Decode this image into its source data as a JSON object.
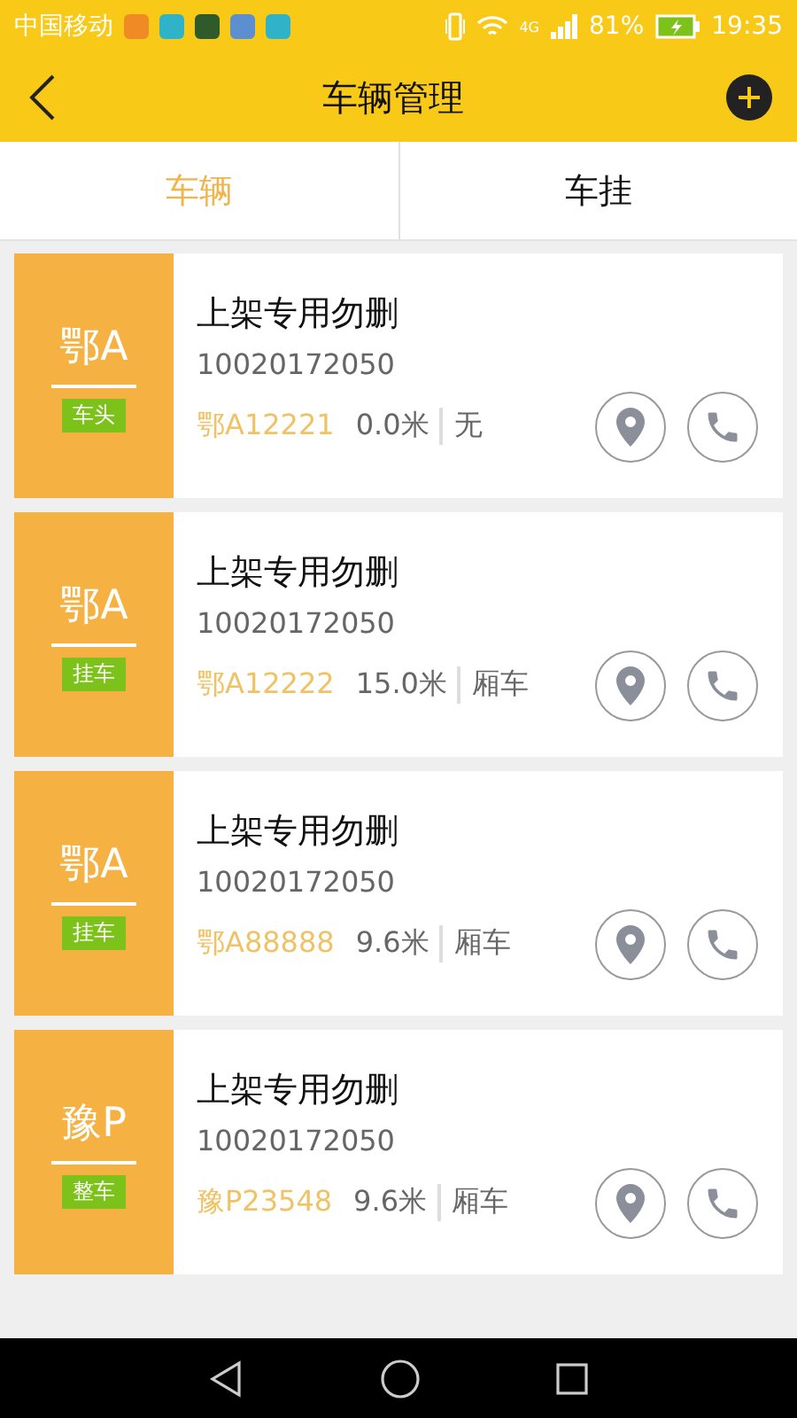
{
  "status_bar": {
    "carrier": "中国移动",
    "signal_label": "4G",
    "battery": "81%",
    "time": "19:35"
  },
  "header": {
    "title": "车辆管理"
  },
  "tabs": [
    {
      "label": "车辆",
      "selected": true
    },
    {
      "label": "车挂",
      "selected": false
    }
  ],
  "vehicles": [
    {
      "region": "鄂A",
      "type": "车头",
      "name": "上架专用勿删",
      "id": "10020172050",
      "plate": "鄂A12221",
      "length": "0.0米",
      "body": "无"
    },
    {
      "region": "鄂A",
      "type": "挂车",
      "name": "上架专用勿删",
      "id": "10020172050",
      "plate": "鄂A12222",
      "length": "15.0米",
      "body": "厢车"
    },
    {
      "region": "鄂A",
      "type": "挂车",
      "name": "上架专用勿删",
      "id": "10020172050",
      "plate": "鄂A88888",
      "length": "9.6米",
      "body": "厢车"
    },
    {
      "region": "豫P",
      "type": "整车",
      "name": "上架专用勿删",
      "id": "10020172050",
      "plate": "豫P23548",
      "length": "9.6米",
      "body": "厢车"
    }
  ]
}
